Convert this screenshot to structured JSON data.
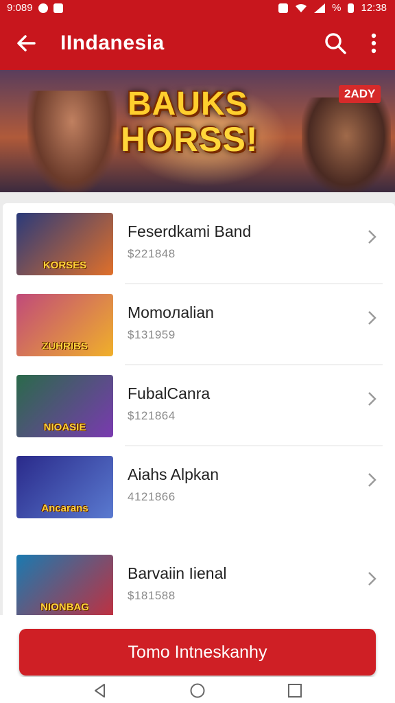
{
  "status": {
    "time_left": "9:089",
    "battery_text": "%",
    "clock": "12:38"
  },
  "appbar": {
    "title": "IIndanesia",
    "back_icon": "arrow-left-icon",
    "search_icon": "search-icon",
    "more_icon": "more-vert-icon"
  },
  "banner": {
    "logo_line1": "BAUKS",
    "logo_line2": "HORSS!",
    "badge": "2ADY"
  },
  "items": [
    {
      "name": "Feserdkami Band",
      "price": "$221848",
      "thumb_label": "KORSES",
      "colors": [
        "#2a3a7a",
        "#e0702a"
      ]
    },
    {
      "name": "Momoлalian",
      "price": "$131959",
      "thumb_label": "ZUHRIBS",
      "colors": [
        "#c04a7a",
        "#f0b02a"
      ]
    },
    {
      "name": "FubalCanra",
      "price": "$121864",
      "thumb_label": "NIOASIE",
      "colors": [
        "#2a6a4a",
        "#7a3ab0"
      ]
    },
    {
      "name": "Aiahs Alpkan",
      "price": "4121866",
      "thumb_label": "Ancarans",
      "colors": [
        "#2a2a8a",
        "#5a7ad0"
      ]
    },
    {
      "name": "Barvaiin Iienal",
      "price": "$181588",
      "thumb_label": "NIONBAG",
      "colors": [
        "#1a7ab0",
        "#c03040"
      ]
    }
  ],
  "cta": {
    "label": "Tomo Intneskanhy"
  },
  "colors": {
    "primary": "#c8161d",
    "accent": "#cf1f25"
  }
}
